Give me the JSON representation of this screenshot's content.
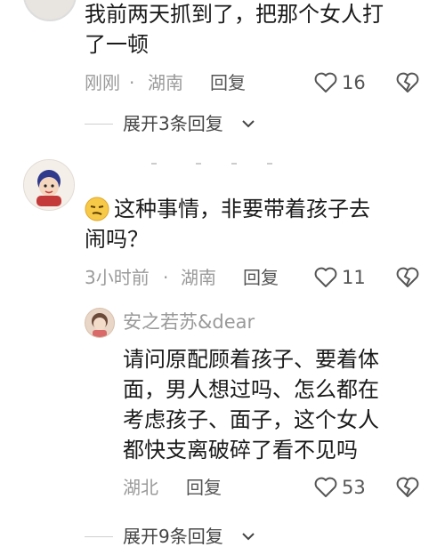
{
  "comments": [
    {
      "text_line1": "我前两天抓到了，把那个女人打",
      "text_line2": "了一顿",
      "time": "刚刚",
      "separator": "·",
      "location": "湖南",
      "reply_label": "回复",
      "likes": "16",
      "expand_label": "展开3条回复"
    },
    {
      "text_line1": "这种事情，非要带着孩子去",
      "text_line2": "闹吗？",
      "time": "3小时前",
      "separator": "·",
      "location": "湖南",
      "reply_label": "回复",
      "likes": "11",
      "sub_reply": {
        "username": "安之若苏&dear",
        "lines": [
          "请问原配顾着孩子、要着体",
          "面，男人想过吗、怎么都在",
          "考虑孩子、面子，这个女人",
          "都快支离破碎了看不见吗"
        ],
        "location": "湖北",
        "reply_label": "回复",
        "likes": "53"
      },
      "expand_label": "展开9条回复"
    }
  ],
  "icons": {
    "like": "heart-outline-icon",
    "dislike": "broken-heart-icon",
    "expand": "chevron-down-icon",
    "emoji": "smirk-emoji-icon"
  },
  "colors": {
    "meta_gray": "#9a9a9a",
    "line_gray": "#cfcfcf"
  }
}
